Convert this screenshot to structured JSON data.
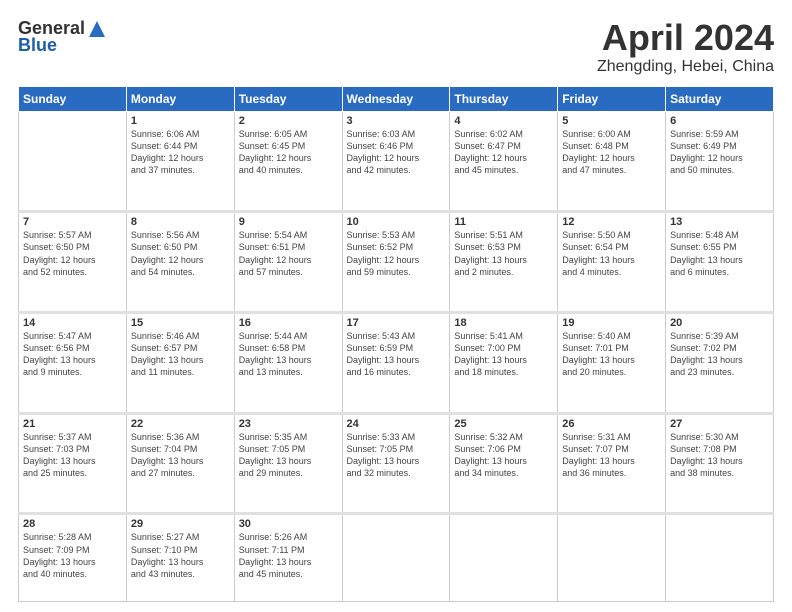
{
  "header": {
    "logo_general": "General",
    "logo_blue": "Blue",
    "month_title": "April 2024",
    "subtitle": "Zhengding, Hebei, China"
  },
  "weekdays": [
    "Sunday",
    "Monday",
    "Tuesday",
    "Wednesday",
    "Thursday",
    "Friday",
    "Saturday"
  ],
  "weeks": [
    [
      {
        "day": "",
        "info": ""
      },
      {
        "day": "1",
        "info": "Sunrise: 6:06 AM\nSunset: 6:44 PM\nDaylight: 12 hours\nand 37 minutes."
      },
      {
        "day": "2",
        "info": "Sunrise: 6:05 AM\nSunset: 6:45 PM\nDaylight: 12 hours\nand 40 minutes."
      },
      {
        "day": "3",
        "info": "Sunrise: 6:03 AM\nSunset: 6:46 PM\nDaylight: 12 hours\nand 42 minutes."
      },
      {
        "day": "4",
        "info": "Sunrise: 6:02 AM\nSunset: 6:47 PM\nDaylight: 12 hours\nand 45 minutes."
      },
      {
        "day": "5",
        "info": "Sunrise: 6:00 AM\nSunset: 6:48 PM\nDaylight: 12 hours\nand 47 minutes."
      },
      {
        "day": "6",
        "info": "Sunrise: 5:59 AM\nSunset: 6:49 PM\nDaylight: 12 hours\nand 50 minutes."
      }
    ],
    [
      {
        "day": "7",
        "info": "Sunrise: 5:57 AM\nSunset: 6:50 PM\nDaylight: 12 hours\nand 52 minutes."
      },
      {
        "day": "8",
        "info": "Sunrise: 5:56 AM\nSunset: 6:50 PM\nDaylight: 12 hours\nand 54 minutes."
      },
      {
        "day": "9",
        "info": "Sunrise: 5:54 AM\nSunset: 6:51 PM\nDaylight: 12 hours\nand 57 minutes."
      },
      {
        "day": "10",
        "info": "Sunrise: 5:53 AM\nSunset: 6:52 PM\nDaylight: 12 hours\nand 59 minutes."
      },
      {
        "day": "11",
        "info": "Sunrise: 5:51 AM\nSunset: 6:53 PM\nDaylight: 13 hours\nand 2 minutes."
      },
      {
        "day": "12",
        "info": "Sunrise: 5:50 AM\nSunset: 6:54 PM\nDaylight: 13 hours\nand 4 minutes."
      },
      {
        "day": "13",
        "info": "Sunrise: 5:48 AM\nSunset: 6:55 PM\nDaylight: 13 hours\nand 6 minutes."
      }
    ],
    [
      {
        "day": "14",
        "info": "Sunrise: 5:47 AM\nSunset: 6:56 PM\nDaylight: 13 hours\nand 9 minutes."
      },
      {
        "day": "15",
        "info": "Sunrise: 5:46 AM\nSunset: 6:57 PM\nDaylight: 13 hours\nand 11 minutes."
      },
      {
        "day": "16",
        "info": "Sunrise: 5:44 AM\nSunset: 6:58 PM\nDaylight: 13 hours\nand 13 minutes."
      },
      {
        "day": "17",
        "info": "Sunrise: 5:43 AM\nSunset: 6:59 PM\nDaylight: 13 hours\nand 16 minutes."
      },
      {
        "day": "18",
        "info": "Sunrise: 5:41 AM\nSunset: 7:00 PM\nDaylight: 13 hours\nand 18 minutes."
      },
      {
        "day": "19",
        "info": "Sunrise: 5:40 AM\nSunset: 7:01 PM\nDaylight: 13 hours\nand 20 minutes."
      },
      {
        "day": "20",
        "info": "Sunrise: 5:39 AM\nSunset: 7:02 PM\nDaylight: 13 hours\nand 23 minutes."
      }
    ],
    [
      {
        "day": "21",
        "info": "Sunrise: 5:37 AM\nSunset: 7:03 PM\nDaylight: 13 hours\nand 25 minutes."
      },
      {
        "day": "22",
        "info": "Sunrise: 5:36 AM\nSunset: 7:04 PM\nDaylight: 13 hours\nand 27 minutes."
      },
      {
        "day": "23",
        "info": "Sunrise: 5:35 AM\nSunset: 7:05 PM\nDaylight: 13 hours\nand 29 minutes."
      },
      {
        "day": "24",
        "info": "Sunrise: 5:33 AM\nSunset: 7:05 PM\nDaylight: 13 hours\nand 32 minutes."
      },
      {
        "day": "25",
        "info": "Sunrise: 5:32 AM\nSunset: 7:06 PM\nDaylight: 13 hours\nand 34 minutes."
      },
      {
        "day": "26",
        "info": "Sunrise: 5:31 AM\nSunset: 7:07 PM\nDaylight: 13 hours\nand 36 minutes."
      },
      {
        "day": "27",
        "info": "Sunrise: 5:30 AM\nSunset: 7:08 PM\nDaylight: 13 hours\nand 38 minutes."
      }
    ],
    [
      {
        "day": "28",
        "info": "Sunrise: 5:28 AM\nSunset: 7:09 PM\nDaylight: 13 hours\nand 40 minutes."
      },
      {
        "day": "29",
        "info": "Sunrise: 5:27 AM\nSunset: 7:10 PM\nDaylight: 13 hours\nand 43 minutes."
      },
      {
        "day": "30",
        "info": "Sunrise: 5:26 AM\nSunset: 7:11 PM\nDaylight: 13 hours\nand 45 minutes."
      },
      {
        "day": "",
        "info": ""
      },
      {
        "day": "",
        "info": ""
      },
      {
        "day": "",
        "info": ""
      },
      {
        "day": "",
        "info": ""
      }
    ]
  ]
}
